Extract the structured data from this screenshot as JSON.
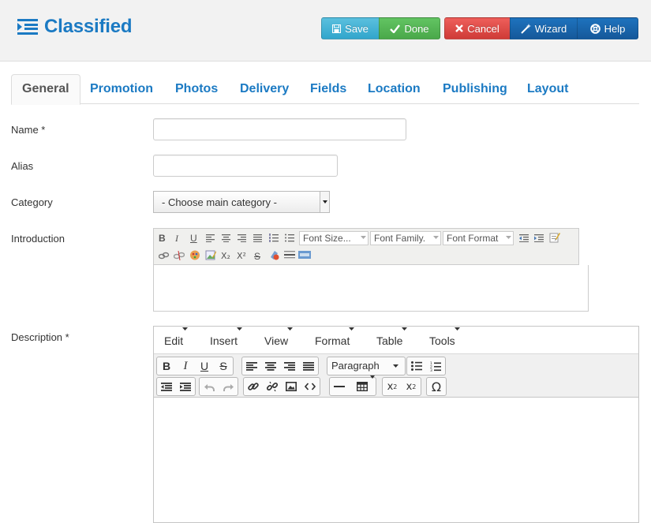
{
  "header": {
    "title": "Classified",
    "buttons": {
      "save": "Save",
      "done": "Done",
      "cancel": "Cancel",
      "wizard": "Wizard",
      "help": "Help"
    }
  },
  "tabs": [
    {
      "label": "General",
      "active": true
    },
    {
      "label": "Promotion"
    },
    {
      "label": "Photos"
    },
    {
      "label": "Delivery"
    },
    {
      "label": "Fields"
    },
    {
      "label": "Location"
    },
    {
      "label": "Publishing"
    },
    {
      "label": "Layout"
    }
  ],
  "form": {
    "name": {
      "label": "Name *",
      "value": ""
    },
    "alias": {
      "label": "Alias",
      "value": ""
    },
    "category": {
      "label": "Category",
      "selected": "- Choose main category -"
    },
    "introduction": {
      "label": "Introduction",
      "font_size": "Font Size...",
      "font_family": "Font Family.",
      "font_format": "Font Format",
      "b": "B",
      "i": "I",
      "u": "U",
      "sub": "X₂",
      "sup": "X²",
      "strike": "S"
    },
    "description": {
      "label": "Description *",
      "menu": [
        "Edit",
        "Insert",
        "View",
        "Format",
        "Table",
        "Tools"
      ],
      "paragraph": "Paragraph",
      "b": "B",
      "i": "I",
      "u": "U",
      "s": "S",
      "omega": "Ω"
    }
  },
  "colors": {
    "brand": "#1b7ac3",
    "save": "#5bc0de",
    "done": "#62c462",
    "cancel": "#ee5f5b",
    "wizard": "#1e73be",
    "help": "#1e73be"
  }
}
